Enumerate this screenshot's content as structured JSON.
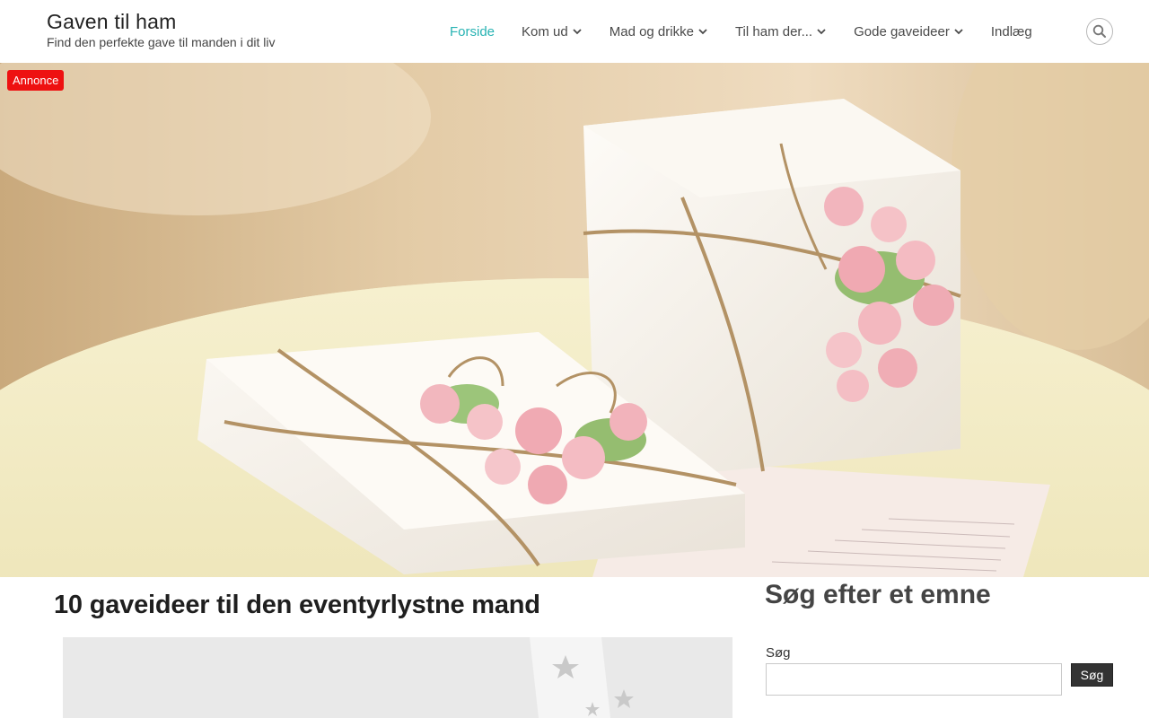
{
  "site": {
    "title": "Gaven til ham",
    "description": "Find den perfekte gave til manden i dit liv"
  },
  "nav": {
    "items": [
      {
        "label": "Forside",
        "active": true,
        "has_submenu": false
      },
      {
        "label": "Kom ud",
        "active": false,
        "has_submenu": true
      },
      {
        "label": "Mad og drikke",
        "active": false,
        "has_submenu": true
      },
      {
        "label": "Til ham der...",
        "active": false,
        "has_submenu": true
      },
      {
        "label": "Gode gaveideer",
        "active": false,
        "has_submenu": true
      },
      {
        "label": "Indlæg",
        "active": false,
        "has_submenu": false
      }
    ],
    "search_icon": "search-icon"
  },
  "hero": {
    "ad_badge": "Annonce",
    "image": "gift-boxes-with-pink-roses"
  },
  "post": {
    "title": "10 gaveideer til den eventyrlystne mand",
    "image": "post-featured-image"
  },
  "sidebar": {
    "widget_title": "Søg efter et emne",
    "search_label": "Søg",
    "search_value": "",
    "search_button": "Søg"
  },
  "colors": {
    "accent": "#27b3b3",
    "ad_badge": "#ee1111",
    "button": "#333333"
  }
}
